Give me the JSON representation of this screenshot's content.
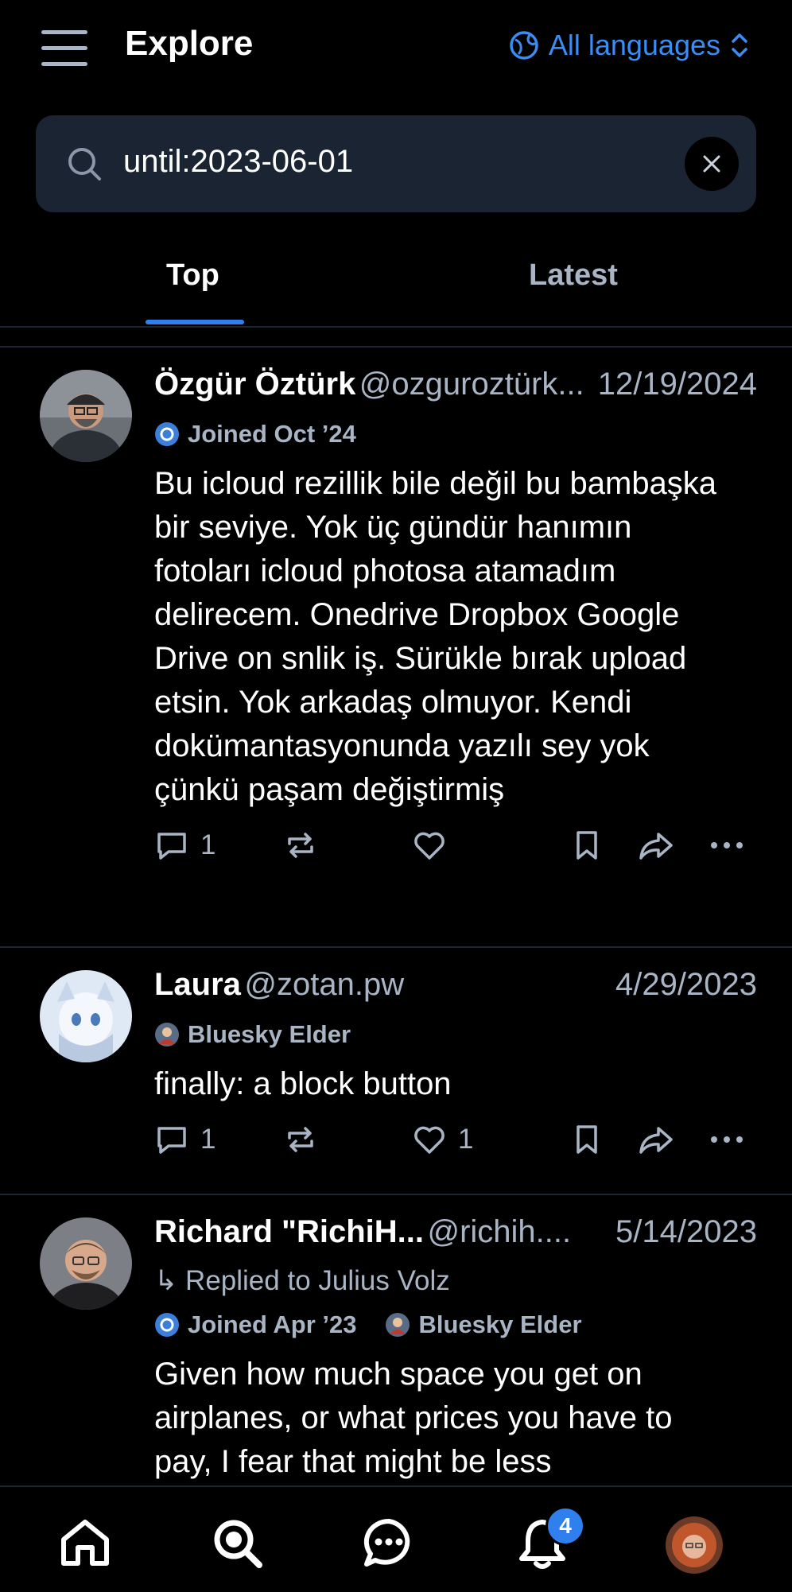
{
  "header": {
    "title": "Explore",
    "language_label": "All languages"
  },
  "search": {
    "value": "until:2023-06-01"
  },
  "tabs": [
    {
      "label": "Top",
      "selected": true
    },
    {
      "label": "Latest",
      "selected": false
    }
  ],
  "posts": [
    {
      "name": "Özgür Öztürk",
      "handle": "@ozguroztürk...",
      "date": "12/19/2024",
      "badges": [
        {
          "label": "Joined Oct ’24"
        }
      ],
      "text": "Bu icloud rezillik bile değil bu bambaşka bir seviye.  Yok üç gündür hanımın fotoları icloud photosa atamadım delirecem. Onedrive Dropbox Google Drive on snlik iş. Sürükle bırak upload etsin. Yok arkadaş olmuyor. Kendi dokümantasyonunda yazılı sey yok çünkü paşam değiştirmiş",
      "reply_count": "1",
      "like_count": ""
    },
    {
      "name": "Laura",
      "handle": "@zotan.pw",
      "date": "4/29/2023",
      "badges": [
        {
          "label": "Bluesky Elder"
        }
      ],
      "text": "finally: a block button",
      "reply_count": "1",
      "like_count": "1"
    },
    {
      "name": "Richard \"RichiH...",
      "handle": "@richih....",
      "date": "5/14/2023",
      "reply_to": "↳ Replied to Julius Volz",
      "badges": [
        {
          "label": "Joined Apr ’23"
        },
        {
          "label": "Bluesky Elder"
        }
      ],
      "text": "Given how much space you get on airplanes, or what prices you have to pay, I fear that might be less"
    }
  ],
  "bottom_nav": {
    "notification_count": "4"
  },
  "colors": {
    "accent": "#2f7fee",
    "muted": "#a9b4c4",
    "search_bg": "#1b2433",
    "background": "#000000"
  }
}
